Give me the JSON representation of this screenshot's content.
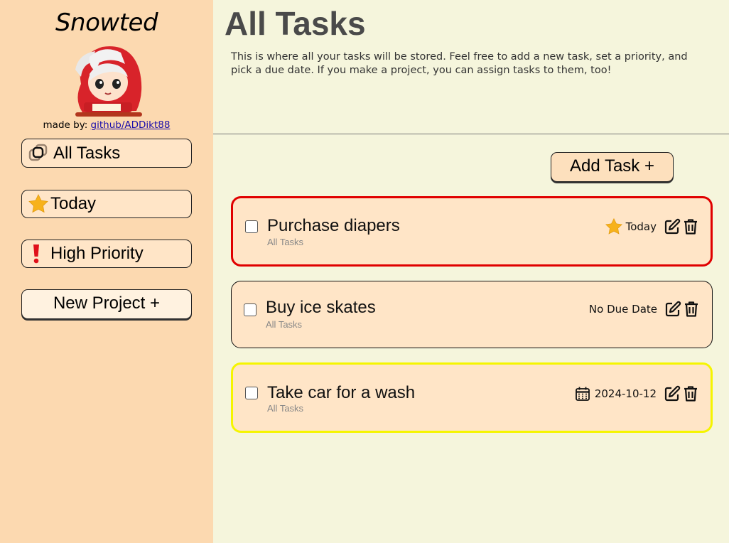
{
  "sidebar": {
    "brand": "Snowted",
    "credit_prefix": "made by:",
    "credit_link": "github/ADDikt88",
    "nav": [
      {
        "label": "All Tasks",
        "icon": "overlapping-squares-icon"
      },
      {
        "label": "Today",
        "icon": "star-icon"
      },
      {
        "label": "High Priority",
        "icon": "exclamation-icon"
      }
    ],
    "new_project_label": "New Project +"
  },
  "main": {
    "title": "All Tasks",
    "description": "This is where all your tasks will be stored. Feel free to add a new task, set a priority, and pick a due date. If you make a project, you can assign tasks to them, too!",
    "add_task_label": "Add Task +",
    "tasks": [
      {
        "name": "Purchase diapers",
        "project": "All Tasks",
        "due": "Today",
        "due_icon": "star-icon",
        "border_color": "#e00000"
      },
      {
        "name": "Buy ice skates",
        "project": "All Tasks",
        "due": "No Due Date",
        "due_icon": "",
        "border_color": "#111111"
      },
      {
        "name": "Take car for a wash",
        "project": "All Tasks",
        "due": "2024-10-12",
        "due_icon": "calendar-icon",
        "border_color": "#f5f500"
      }
    ]
  },
  "colors": {
    "sidebar_bg": "#fcd9b0",
    "main_bg": "#f5f5dc",
    "card_bg": "#ffe5c7",
    "star": "#f7b21b",
    "priority_high": "#e00000",
    "priority_medium": "#f5f500"
  }
}
